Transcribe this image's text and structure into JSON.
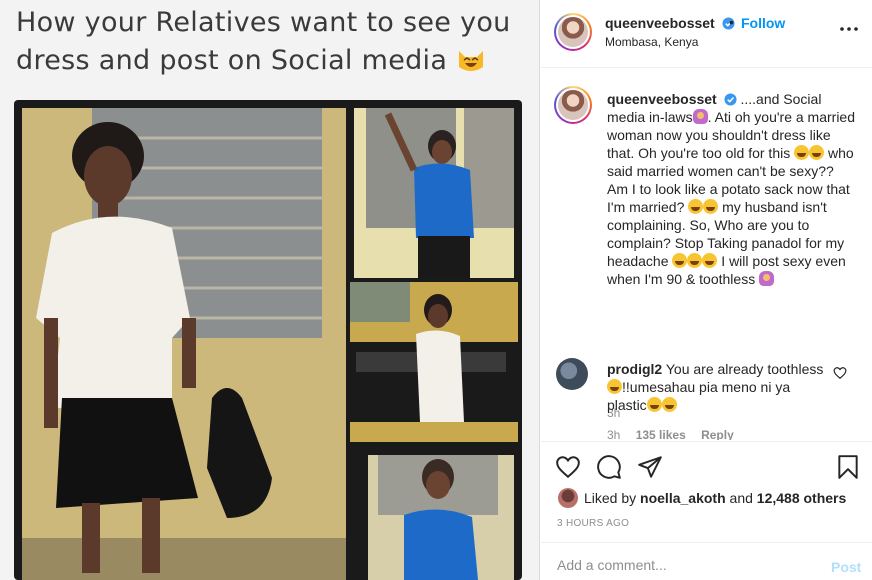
{
  "meme": {
    "caption_line1": "How your Relatives want to see you",
    "caption_line2": "dress and post on Social media"
  },
  "header": {
    "username": "queenveebosset",
    "separator": "•",
    "follow_label": "Follow",
    "location": "Mombasa, Kenya"
  },
  "caption": {
    "username": "queenveebosset",
    "part1": "....and Social media in-laws",
    "part2": ". Ati oh you're a married woman now you shouldn't dress like that. Oh you're too old for this",
    "part3": "who said married women can't be sexy?? Am I to look like a potato sack now that I'm married?",
    "part4": "my husband isn't complaining. So, Who are you to complain? Stop Taking panadol for my headache",
    "part5": "I will post sexy even when I'm 90 & toothless",
    "time": "3h"
  },
  "comment": {
    "username": "prodigl2",
    "part1": "You are already toothless",
    "part2": "!!umesahau pia meno ni ya plastic",
    "time": "3h",
    "likes": "135 likes",
    "reply": "Reply"
  },
  "liked_by": {
    "prefix": "Liked by",
    "user": "noella_akoth",
    "connector": "and",
    "others": "12,488 others"
  },
  "date": "3 HOURS AGO",
  "add_comment": {
    "placeholder": "Add a comment...",
    "post_label": "Post"
  },
  "colors": {
    "accent": "#0095f6",
    "post_disabled": "#b2dffc",
    "muted": "#8e8e8e"
  }
}
